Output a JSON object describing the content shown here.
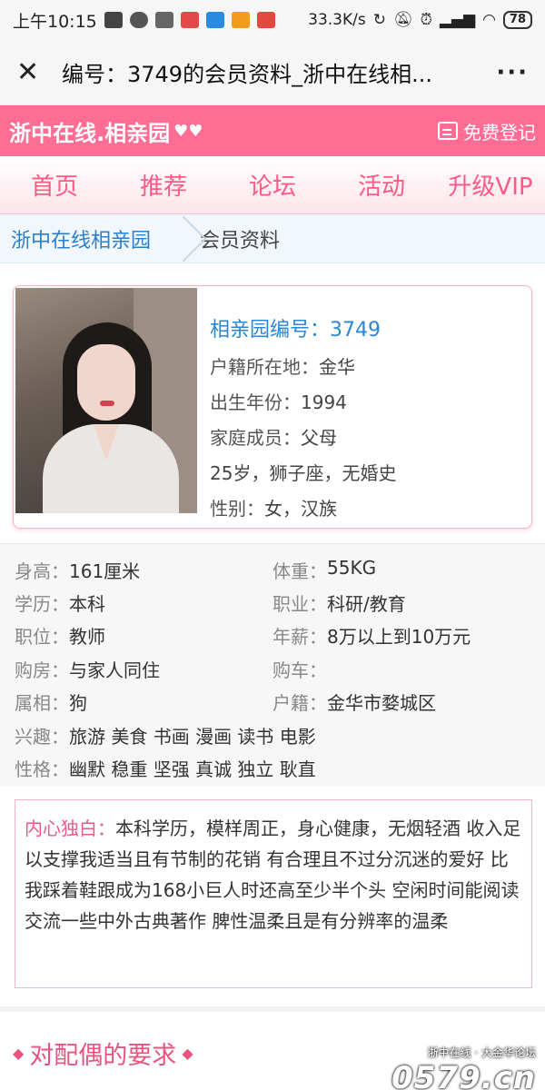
{
  "statusbar": {
    "time": "上午10:15",
    "speed": "33.3K/s",
    "battery": "78"
  },
  "titlebar": {
    "close_icon": "close-icon",
    "title": "编号：3749的会员资料_浙中在线相...",
    "more": "···"
  },
  "site": {
    "logo": "浙中在线.相亲园",
    "register": "免费登记"
  },
  "nav": [
    "首页",
    "推荐",
    "论坛",
    "活动",
    "升级VIP"
  ],
  "breadcrumb": {
    "home": "浙中在线相亲园",
    "current": "会员资料"
  },
  "profile": {
    "id_line": "相亲园编号：3749",
    "hukou_label": "户籍所在地：",
    "hukou": "金华",
    "birth_label": "出生年份：",
    "birth": "1994",
    "family_label": "家庭成员：",
    "family": "父母",
    "summary": "25岁，狮子座，无婚史",
    "gender_label": "性别：",
    "gender": "女，汉族"
  },
  "details": {
    "height_label": "身高：",
    "height": "161厘米",
    "weight_label": "体重：",
    "weight": "55KG",
    "edu_label": "学历：",
    "edu": "本科",
    "job_label": "职业：",
    "job": "科研/教育",
    "position_label": "职位：",
    "position": "教师",
    "salary_label": "年薪：",
    "salary": "8万以上到10万元",
    "house_label": "购房：",
    "house": "与家人同住",
    "car_label": "购车：",
    "car": "",
    "zodiac_label": "属相：",
    "zodiac": "狗",
    "residence_label": "户籍：",
    "residence": "金华市婺城区",
    "hobby_label": "兴趣：",
    "hobby": "旅游 美食 书画 漫画 读书 电影",
    "character_label": "性格：",
    "character": "幽默 稳重 坚强 真诚 独立 耿直"
  },
  "monologue": {
    "label": "内心独白：",
    "text": "本科学历，模样周正，身心健康，无烟轻酒 收入足以支撑我适当且有节制的花销 有合理且不过分沉迷的爱好 比我踩着鞋跟成为168小巨人时还高至少半个头 空闲时间能阅读交流一些中外古典著作 脾性温柔且是有分辨率的温柔"
  },
  "requirements": {
    "title": "对配偶的要求"
  },
  "watermark": {
    "small": "浙中在线 · 大金华论坛",
    "big": "0579.cn"
  }
}
